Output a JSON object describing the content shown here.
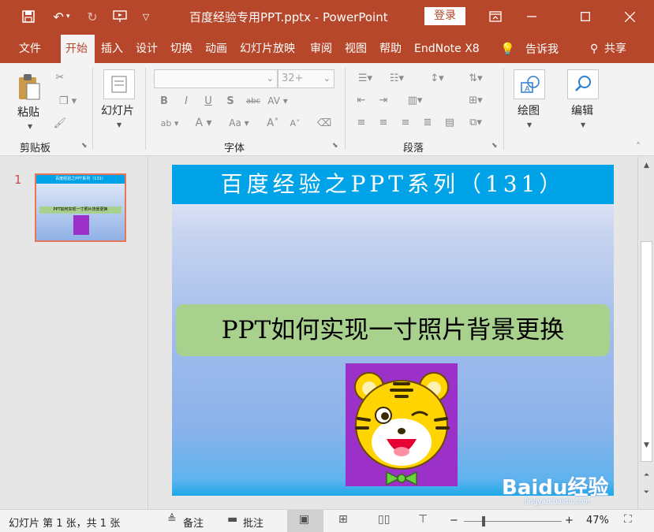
{
  "titlebar": {
    "doc_title": "百度经验专用PPT.pptx  -  PowerPoint",
    "login_label": "登录"
  },
  "tabs": [
    "文件",
    "开始",
    "插入",
    "设计",
    "切换",
    "动画",
    "幻灯片放映",
    "审阅",
    "视图",
    "帮助",
    "EndNote X8",
    "告诉我",
    "共享"
  ],
  "ribbon": {
    "clipboard": {
      "paste_label": "粘贴",
      "group_label": "剪贴板"
    },
    "slides": {
      "new_slide_label": "幻灯片"
    },
    "font": {
      "font_name": "",
      "font_size": "32+",
      "group_label": "字体"
    },
    "paragraph": {
      "group_label": "段落"
    },
    "drawing": {
      "label": "绘图"
    },
    "editing": {
      "label": "编辑"
    }
  },
  "thumbnail": {
    "number": "1",
    "header": "百度经验之PPT系列（131）",
    "subtitle": "PPT如何实现一寸照片背景更换"
  },
  "slide": {
    "header": "百度经验之PPT系列（131）",
    "subtitle": "PPT如何实现一寸照片背景更换"
  },
  "watermark": {
    "logo_text": "Baidu经验",
    "url": "jingyan.baidu.com"
  },
  "statusbar": {
    "slide_info": "幻灯片 第 1 张，共 1 张",
    "notes_label": "备注",
    "comments_label": "批注",
    "zoom_percent": "47%",
    "zoom_level": 0.47
  },
  "colors": {
    "accent": "#b7472a",
    "slide_header": "#00a2e8",
    "subtitle_box": "#a9d18e",
    "image_bg": "#9b31c9"
  }
}
